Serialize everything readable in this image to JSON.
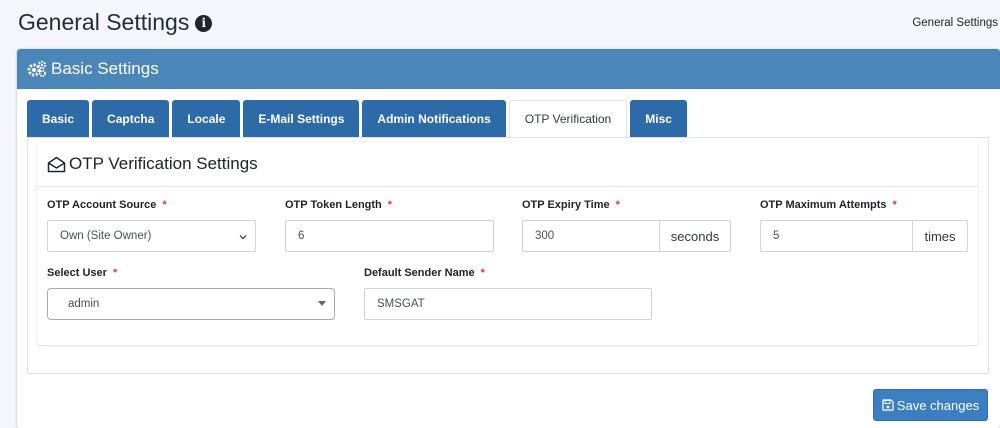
{
  "header": {
    "title": "General Settings",
    "breadcrumb": "General Settings"
  },
  "card": {
    "title": "Basic Settings"
  },
  "tabs": [
    {
      "label": "Basic",
      "active": false
    },
    {
      "label": "Captcha",
      "active": false
    },
    {
      "label": "Locale",
      "active": false
    },
    {
      "label": "E-Mail Settings",
      "active": false
    },
    {
      "label": "Admin Notifications",
      "active": false
    },
    {
      "label": "OTP Verification",
      "active": true
    },
    {
      "label": "Misc",
      "active": false
    }
  ],
  "section": {
    "title": "OTP Verification Settings"
  },
  "fields": {
    "account_source": {
      "label": "OTP Account Source",
      "required": "*",
      "value": "Own (Site Owner)"
    },
    "token_length": {
      "label": "OTP Token Length",
      "required": "*",
      "value": "6"
    },
    "expiry_time": {
      "label": "OTP Expiry Time",
      "required": "*",
      "value": "300",
      "unit": "seconds"
    },
    "max_attempts": {
      "label": "OTP Maximum Attempts",
      "required": "*",
      "value": "5",
      "unit": "times"
    },
    "select_user": {
      "label": "Select User",
      "required": "*",
      "value": "admin"
    },
    "sender_name": {
      "label": "Default Sender Name",
      "required": "*",
      "value": "SMSGAT"
    }
  },
  "actions": {
    "save_label": "Save changes"
  },
  "colors": {
    "header_bg": "#4a86b8",
    "tab_bg": "#2c6aa8",
    "button_bg": "#3b7fc0",
    "required": "#dc3545"
  }
}
